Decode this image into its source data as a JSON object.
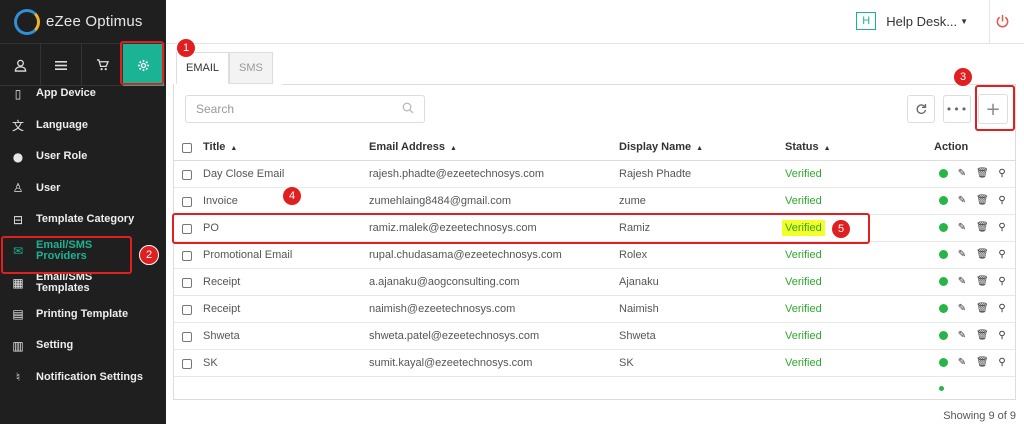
{
  "app": {
    "title": "eZee Optimus"
  },
  "topbar": {
    "help_badge": "H",
    "help_label": "Help Desk...",
    "power_icon": "power-icon"
  },
  "iconbar": [
    "user-icon",
    "menu-icon",
    "cart-icon",
    "gear-icon"
  ],
  "sidebar": {
    "items": [
      {
        "label": "App Device",
        "icon": "device-icon"
      },
      {
        "label": "Language",
        "icon": "language-icon"
      },
      {
        "label": "User Role",
        "icon": "user-role-icon"
      },
      {
        "label": "User",
        "icon": "user-icon"
      },
      {
        "label": "Template Category",
        "icon": "inbox-icon"
      },
      {
        "label": "Email/SMS Providers",
        "icon": "envelope-icon"
      },
      {
        "label": "Email/SMS Templates",
        "icon": "calendar-icon"
      },
      {
        "label": "Printing Template",
        "icon": "document-icon"
      },
      {
        "label": "Setting",
        "icon": "settings-icon"
      },
      {
        "label": "Notification Settings",
        "icon": "bell-icon"
      }
    ]
  },
  "tabs": [
    {
      "label": "EMAIL"
    },
    {
      "label": "SMS"
    }
  ],
  "search": {
    "placeholder": "Search"
  },
  "table": {
    "columns": [
      "Title",
      "Email Address",
      "Display Name",
      "Status",
      "Action"
    ],
    "rows": [
      {
        "title": "Day Close Email",
        "email": "rajesh.phadte@ezeetechnosys.com",
        "name": "Rajesh Phadte",
        "status": "Verified"
      },
      {
        "title": "Invoice",
        "email": "zumehlaing8484@gmail.com",
        "name": "zume",
        "status": "Verified"
      },
      {
        "title": "PO",
        "email": "ramiz.malek@ezeetechnosys.com",
        "name": "Ramiz",
        "status": "Verified"
      },
      {
        "title": "Promotional Email",
        "email": "rupal.chudasama@ezeetechnosys.com",
        "name": "Rolex",
        "status": "Verified"
      },
      {
        "title": "Receipt",
        "email": "a.ajanaku@aogconsulting.com",
        "name": "Ajanaku",
        "status": "Verified"
      },
      {
        "title": "Receipt",
        "email": "naimish@ezeetechnosys.com",
        "name": "Naimish",
        "status": "Verified"
      },
      {
        "title": "Shweta",
        "email": "shweta.patel@ezeetechnosys.com",
        "name": "Shweta",
        "status": "Verified"
      },
      {
        "title": "SK",
        "email": "sumit.kayal@ezeetechnosys.com",
        "name": "SK",
        "status": "Verified"
      }
    ]
  },
  "footer": {
    "text": "Showing 9 of 9"
  },
  "annotations": [
    "1",
    "2",
    "3",
    "4",
    "5"
  ],
  "colors": {
    "accent": "#1ab394",
    "annotation": "#e02020",
    "verified": "#2fa82f",
    "highlight": "#f4ff2a"
  }
}
